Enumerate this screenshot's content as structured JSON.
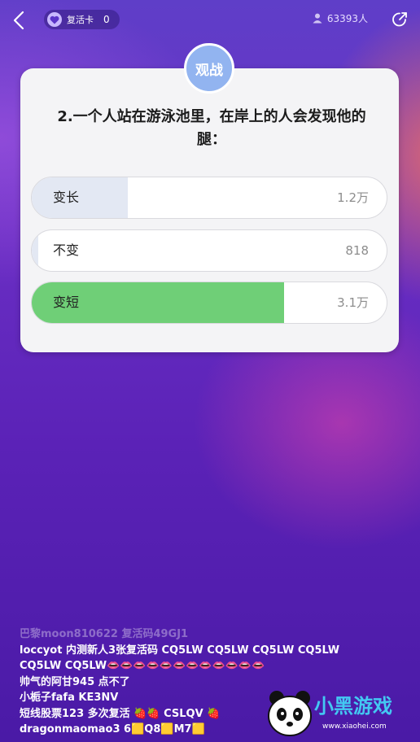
{
  "header": {
    "revive_card_label": "复活卡",
    "revive_card_count": "0",
    "online_count": "63393人"
  },
  "card": {
    "badge_label": "观战",
    "question_line1": "2.一个人站在游泳池里，在岸上的人会发现他的",
    "question_line2": "腿：",
    "options": [
      {
        "label": "变长",
        "votes": "1.2万",
        "fill_fraction": 0.27,
        "fill_color": "#e3e8f3"
      },
      {
        "label": "不变",
        "votes": "818",
        "fill_fraction": 0.018,
        "fill_color": "#e3e8f3"
      },
      {
        "label": "变短",
        "votes": "3.1万",
        "fill_fraction": 0.71,
        "fill_color": "#6fcf77"
      }
    ]
  },
  "comments": [
    {
      "text": "巴黎moon810622 复活码49GJ1"
    },
    {
      "text": "loccyot 内测新人3张复活码 CQ5LW CQ5LW CQ5LW CQ5LW"
    },
    {
      "text": "CQ5LW CQ5LW👄👄👄👄👄👄👄👄👄👄👄👄"
    },
    {
      "text": "帅气的阿甘945 点不了"
    },
    {
      "text": "小栀子fafa KE3NV"
    },
    {
      "text": "短线股票123 多次复活 🍓🍓 CSLQV 🍓"
    },
    {
      "text": "dragonmaomao3 6🟨Q8🟨M7🟨"
    }
  ],
  "watermark": {
    "brand": "小黑游戏",
    "url": "www.xiaohei.com"
  }
}
